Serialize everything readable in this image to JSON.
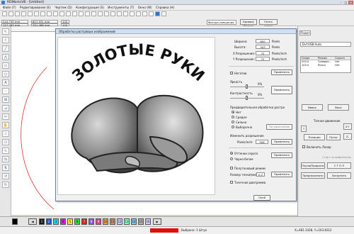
{
  "window": {
    "title": "RDWorksV8 · [Untitled]",
    "min": "–",
    "max": "□",
    "close": "✕"
  },
  "menu": [
    "Файл (F)",
    "Редактирование (E)",
    "Чертеж (D)",
    "Конфигурация (S)",
    "Инструменты (T)",
    "Окно (W)",
    "Справка (H)"
  ],
  "toolbar": {
    "x_val": "244.735 mm",
    "y_val": "157.283 mm",
    "w_val": "607.931 mm",
    "h_val": "291.488 mm",
    "pct1": "100",
    "pct2": "100",
    "layer_select": "Фигура смещения",
    "btn_offset": "Кривая/Фильтр",
    "btn_close": "Опять линия"
  },
  "dialog": {
    "title": "Обработка растровых изображений",
    "image_caption": "ЗОЛОТЫЕ РУКИ",
    "width_label": "Ширина:",
    "width_val": "600",
    "width_unit": "Pixels",
    "height_label": "Высота:",
    "height_val": "343",
    "height_unit": "Pixels",
    "xres_label": "X Разрешение:",
    "xres_val": "72",
    "xres_unit": "Pixels/inch",
    "yres_label": "Y Разрешение:",
    "yres_val": "72",
    "yres_unit": "Pixels/inch",
    "invert_label": "Негатив",
    "apply1": "Применить",
    "brightness_label": "Яркость",
    "brightness_val": "0%",
    "contrast_label": "Контрастность",
    "contrast_val": "0%",
    "apply2": "Применить",
    "prep_label": "Предварительная обработка растра",
    "prep_options": [
      "Нет",
      "Средне",
      "Сильно",
      "Выборочно"
    ],
    "default_btn": "По умолчанию",
    "resize_label": "Изменить разрешение",
    "ppi_label": "Pixels/inch:",
    "ppi_val": "508",
    "apply3": "Применить",
    "bw_opts": [
      "Оттенки серого",
      "Черно-белое"
    ],
    "apply4": "Применить",
    "halftone_label": "Полутоновый режим",
    "dot_label": "Размер точки(мм)",
    "dot_val": "0.2",
    "apply5": "Применить",
    "dotmode_label": "Точечная диаграмма",
    "ok": "Окей"
  },
  "rightpanel": {
    "tab": "Подкл",
    "device": "Dvf:USB:Auto",
    "col_headers": [
      "Скоро",
      "Режим",
      "Скрыть"
    ],
    "rows": [
      [
        "200.0",
        "Гравиро...",
        "Нет"
      ],
      [
        "100.0",
        "Резка",
        "Нет"
      ]
    ],
    "up_btn": "Вверх",
    "down_btn": "Вниз",
    "move_label": "Точное движение",
    "pos_btn": "Позиция",
    "pulse_btn": "Пульс",
    "z_plus": "Z+",
    "z_minus": "Z-",
    "laser_label": "Включить Лазер",
    "speed_label": "Старт по выбранному",
    "pause_btn": "Пауза/Продолж",
    "stop_btn": "С Т О П",
    "preview_btn": "Предпросмотр",
    "load_btn": "Загрузить"
  },
  "palette": [
    "1",
    "2",
    "3",
    "4",
    "5",
    "6",
    "7",
    "8",
    "9",
    "10",
    "11",
    "12",
    "13",
    "14",
    "15",
    "16"
  ],
  "status": {
    "processing": "Выбрано: 1 Штук",
    "coords": "X=481.1428, Y=163.8312"
  }
}
